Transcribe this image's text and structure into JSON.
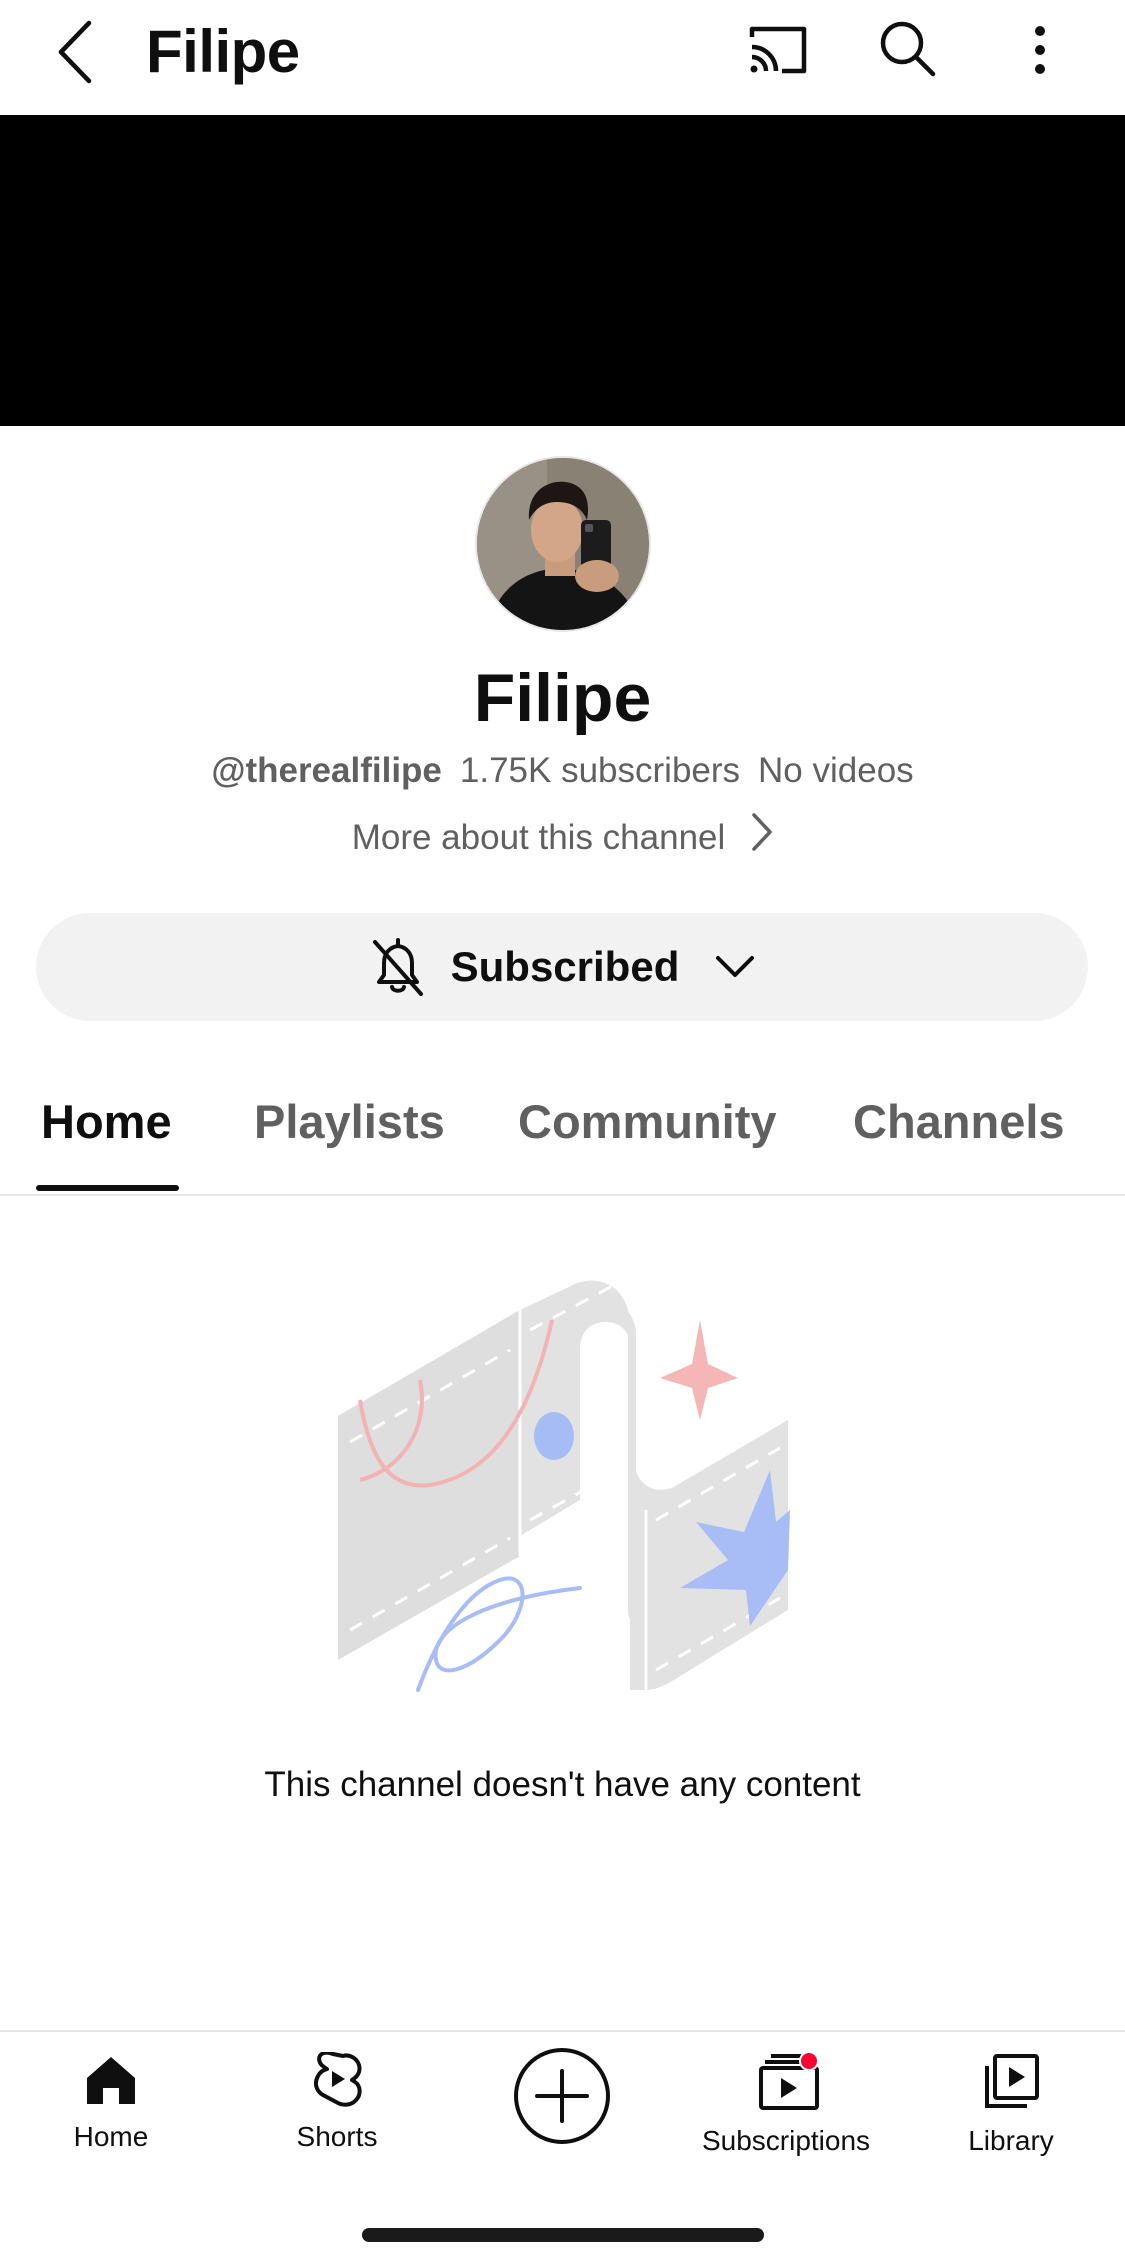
{
  "header": {
    "title": "Filipe"
  },
  "channel": {
    "name": "Filipe",
    "handle": "@therealfilipe",
    "subscribers": "1.75K subscribers",
    "videos": "No videos",
    "more_about": "More about this channel",
    "subscribe_label": "Subscribed"
  },
  "tabs": [
    {
      "label": "Home",
      "active": true
    },
    {
      "label": "Playlists",
      "active": false
    },
    {
      "label": "Community",
      "active": false
    },
    {
      "label": "Channels",
      "active": false
    }
  ],
  "empty_state": {
    "message": "This channel doesn't have any content"
  },
  "bottom_nav": [
    {
      "label": "Home",
      "icon": "home-icon"
    },
    {
      "label": "Shorts",
      "icon": "shorts-icon"
    },
    {
      "label": "",
      "icon": "create-icon"
    },
    {
      "label": "Subscriptions",
      "icon": "subscriptions-icon"
    },
    {
      "label": "Library",
      "icon": "library-icon"
    }
  ],
  "colors": {
    "accent_red": "#ff0033",
    "banner": "#000000",
    "button_bg": "#f2f2f2"
  }
}
